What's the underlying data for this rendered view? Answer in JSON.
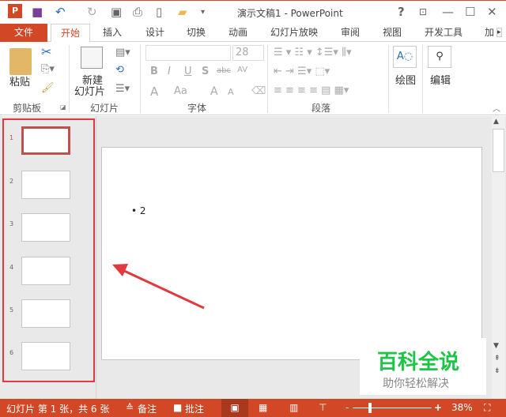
{
  "window": {
    "title": "演示文稿1 - PowerPoint",
    "help": "?",
    "min": "—",
    "max": "☐",
    "close": "✕"
  },
  "qat": {
    "icons": [
      "powerpoint-logo",
      "save-icon",
      "undo-icon",
      "redo-icon",
      "slideshow-icon",
      "print-preview-icon",
      "new-file-icon",
      "open-folder-icon",
      "customize-icon"
    ]
  },
  "tabs": [
    "文件",
    "开始",
    "插入",
    "设计",
    "切换",
    "动画",
    "幻灯片放映",
    "审阅",
    "视图",
    "开发工具",
    "加"
  ],
  "ribbon": {
    "clipboard": {
      "paste": "粘贴",
      "label": "剪贴板"
    },
    "slides": {
      "new_slide": "新建",
      "new_slide2": "幻灯片",
      "label": "幻灯片"
    },
    "font": {
      "name": "",
      "size": "28",
      "bold": "B",
      "italic": "I",
      "underline": "U",
      "shadow": "S",
      "strike": "abc",
      "spacing": "AV",
      "color": "A",
      "case": "Aa",
      "grow": "A",
      "shrink": "A",
      "label": "字体"
    },
    "paragraph": {
      "label": "段落"
    },
    "drawing": {
      "label": "绘图"
    },
    "editing": {
      "label": "编辑"
    }
  },
  "slides": [
    {
      "num": "1",
      "selected": true
    },
    {
      "num": "2"
    },
    {
      "num": "3"
    },
    {
      "num": "4"
    },
    {
      "num": "5"
    },
    {
      "num": "6"
    }
  ],
  "canvas": {
    "bullet": "• 2"
  },
  "watermark": {
    "title": "百科全说",
    "subtitle": "助你轻松解决"
  },
  "status": {
    "slide_info": "幻灯片 第 1 张，共 6 张",
    "notes": "备注",
    "comments": "批注",
    "zoom": "38%",
    "zoom_minus": "-",
    "zoom_plus": "+",
    "zoom_level": 38
  },
  "colors": {
    "accent": "#d24726",
    "highlight": "#e0393e",
    "watermark": "#1ec447"
  }
}
